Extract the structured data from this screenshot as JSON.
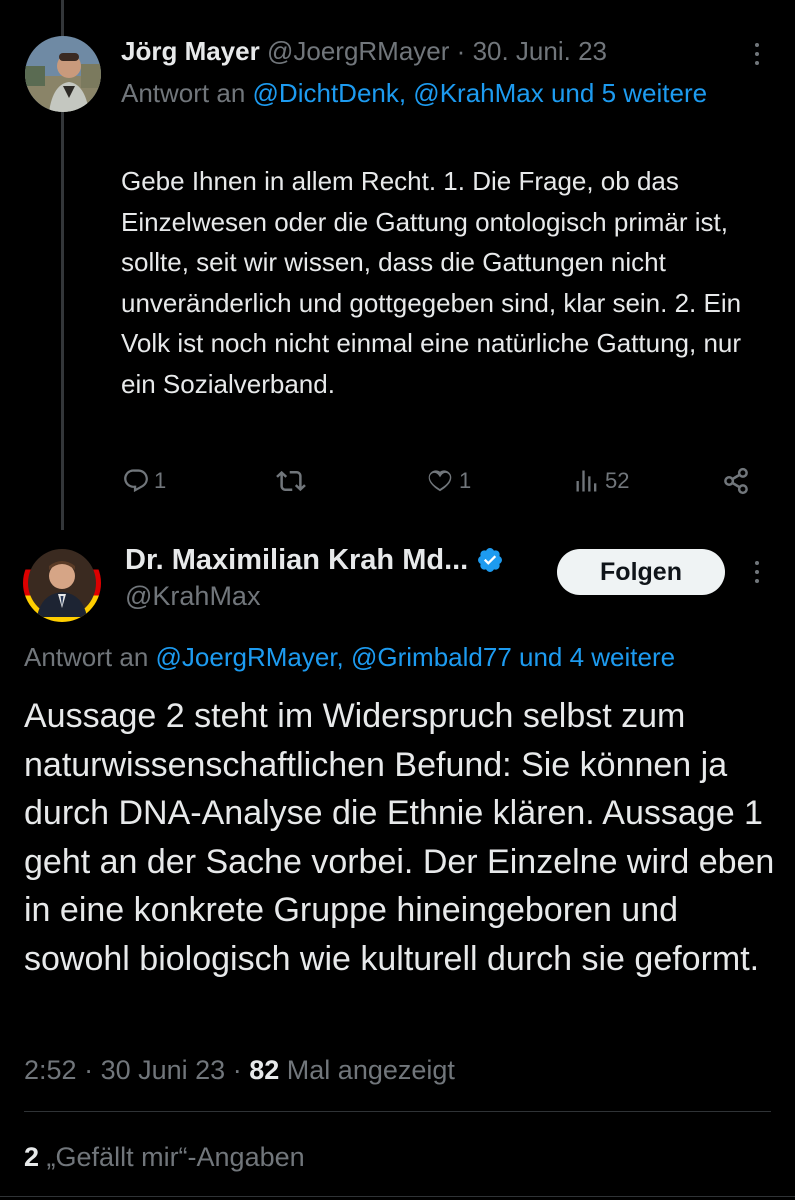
{
  "tweet1": {
    "display_name": "Jörg Mayer",
    "handle": "@JoergRMayer",
    "separator": "·",
    "date": "30. Juni. 23",
    "reply_prefix": "Antwort an",
    "reply_to": "@DichtDenk, @KrahMax und 5 weitere",
    "body": "Gebe Ihnen in allem Recht. 1. Die Frage, ob das Einzelwesen oder die Gattung ontologisch primär ist, sollte, seit wir wissen, dass die Gattungen nicht unveränderlich und gottgegeben sind, klar sein. 2. Ein Volk ist noch nicht einmal eine natürliche Gattung, nur ein Sozialverband.",
    "actions": {
      "replies": "1",
      "retweets": "",
      "likes": "1",
      "views": "52"
    },
    "icons": [
      "reply-icon",
      "retweet-icon",
      "like-icon",
      "views-icon",
      "share-icon",
      "more-icon"
    ]
  },
  "tweet2": {
    "display_name": "Dr. Maximilian Krah Md...",
    "handle": "@KrahMax",
    "verified_icon": "verified-badge-icon",
    "follow_label": "Folgen",
    "reply_prefix": "Antwort an",
    "reply_to": "@JoergRMayer, @Grimbald77 und 4 weitere",
    "body": "Aussage 2 steht im Widerspruch selbst zum naturwissenschaftlichen Befund: Sie können ja durch DNA-Analyse die Ethnie klären. Aussage 1 geht an der Sache vorbei. Der Einzelne wird eben in eine konkrete Gruppe hineingeboren und sowohl biologisch wie kulturell durch sie geformt.",
    "time": "2:52",
    "separator": "·",
    "date": "30 Juni 23",
    "views_count": "82",
    "views_label": "Mal angezeigt",
    "likes_count": "2",
    "likes_label": "„Gefällt mir“-Angaben"
  },
  "colors": {
    "background": "#000000",
    "text": "#e7e9ea",
    "muted": "#71767b",
    "link": "#1d9bf0",
    "button_bg": "#eff3f4",
    "divider": "#2f3336"
  }
}
